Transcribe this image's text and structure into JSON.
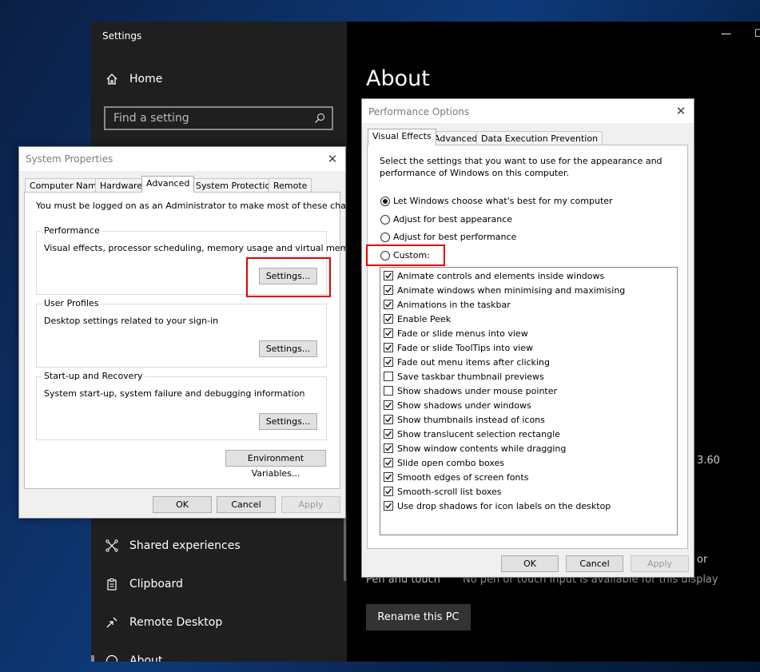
{
  "settings": {
    "window_title": "Settings",
    "min_glyph": "—",
    "max_glyph": "☐",
    "nav": {
      "home": "Home",
      "search_placeholder": "Find a setting",
      "items": [
        "Shared experiences",
        "Clipboard",
        "Remote Desktop",
        "About"
      ]
    },
    "content": {
      "title": "About",
      "version_fragment": "3.60",
      "or_fragment": "or",
      "pen_label": "Pen and touch",
      "pen_value": "No pen or touch input is available for this display",
      "rename_button": "Rename this PC"
    }
  },
  "system_properties": {
    "title": "System Properties",
    "close_glyph": "✕",
    "tabs": [
      "Computer Name",
      "Hardware",
      "Advanced",
      "System Protection",
      "Remote"
    ],
    "active_tab": "Advanced",
    "admin_note": "You must be logged on as an Administrator to make most of these changes.",
    "groups": [
      {
        "label": "Performance",
        "desc": "Visual effects, processor scheduling, memory usage and virtual memory",
        "button": "Settings..."
      },
      {
        "label": "User Profiles",
        "desc": "Desktop settings related to your sign-in",
        "button": "Settings..."
      },
      {
        "label": "Start-up and Recovery",
        "desc": "System start-up, system failure and debugging information",
        "button": "Settings..."
      }
    ],
    "env_button": "Environment Variables...",
    "ok": "OK",
    "cancel": "Cancel",
    "apply": "Apply"
  },
  "performance_options": {
    "title": "Performance Options",
    "close_glyph": "✕",
    "tabs": [
      "Visual Effects",
      "Advanced",
      "Data Execution Prevention"
    ],
    "active_tab": "Visual Effects",
    "intro_line1": "Select the settings that you want to use for the appearance and",
    "intro_line2": "performance of Windows on this computer.",
    "radios": [
      {
        "label": "Let Windows choose what's best for my computer",
        "selected": true
      },
      {
        "label": "Adjust for best appearance",
        "selected": false
      },
      {
        "label": "Adjust for best performance",
        "selected": false
      },
      {
        "label": "Custom:",
        "selected": false
      }
    ],
    "effects": [
      {
        "label": "Animate controls and elements inside windows",
        "checked": true
      },
      {
        "label": "Animate windows when minimising and maximising",
        "checked": true
      },
      {
        "label": "Animations in the taskbar",
        "checked": true
      },
      {
        "label": "Enable Peek",
        "checked": true
      },
      {
        "label": "Fade or slide menus into view",
        "checked": true
      },
      {
        "label": "Fade or slide ToolTips into view",
        "checked": true
      },
      {
        "label": "Fade out menu items after clicking",
        "checked": true
      },
      {
        "label": "Save taskbar thumbnail previews",
        "checked": false
      },
      {
        "label": "Show shadows under mouse pointer",
        "checked": false
      },
      {
        "label": "Show shadows under windows",
        "checked": true
      },
      {
        "label": "Show thumbnails instead of icons",
        "checked": true
      },
      {
        "label": "Show translucent selection rectangle",
        "checked": true
      },
      {
        "label": "Show window contents while dragging",
        "checked": true
      },
      {
        "label": "Slide open combo boxes",
        "checked": true
      },
      {
        "label": "Smooth edges of screen fonts",
        "checked": true
      },
      {
        "label": "Smooth-scroll list boxes",
        "checked": true
      },
      {
        "label": "Use drop shadows for icon labels on the desktop",
        "checked": true
      }
    ],
    "ok": "OK",
    "cancel": "Cancel",
    "apply": "Apply"
  },
  "colors": {
    "highlight": "#e00000",
    "settings_bg": "#000000",
    "nav_bg": "#1f1f1f"
  }
}
